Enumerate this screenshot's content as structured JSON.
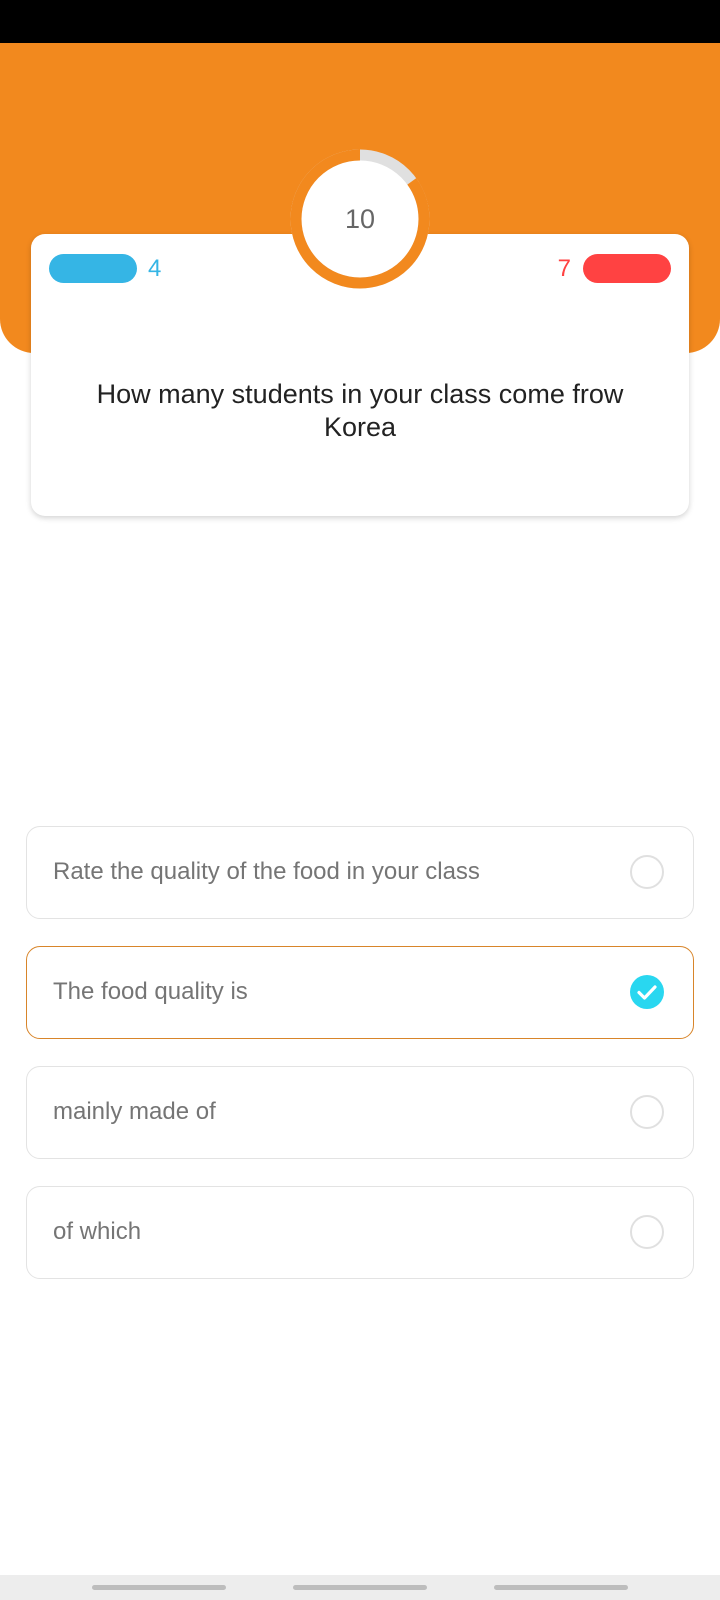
{
  "colors": {
    "header": "#f2891e",
    "correct": "#35b5e5",
    "wrong": "#ff4242",
    "timer_progress": "#f2891e",
    "timer_track": "#e0e0e0",
    "selected_border": "#d8852a",
    "check": "#29d7f0"
  },
  "timer": {
    "value": "10",
    "progress_fraction": 0.85
  },
  "score": {
    "correct_count": "4",
    "wrong_count": "7"
  },
  "question": {
    "text": "How many students in your class come frow Korea"
  },
  "answers": [
    {
      "label": "Rate the quality of the food in your class",
      "selected": false
    },
    {
      "label": "The food quality is",
      "selected": true
    },
    {
      "label": "mainly made of",
      "selected": false
    },
    {
      "label": "of which",
      "selected": false
    }
  ]
}
